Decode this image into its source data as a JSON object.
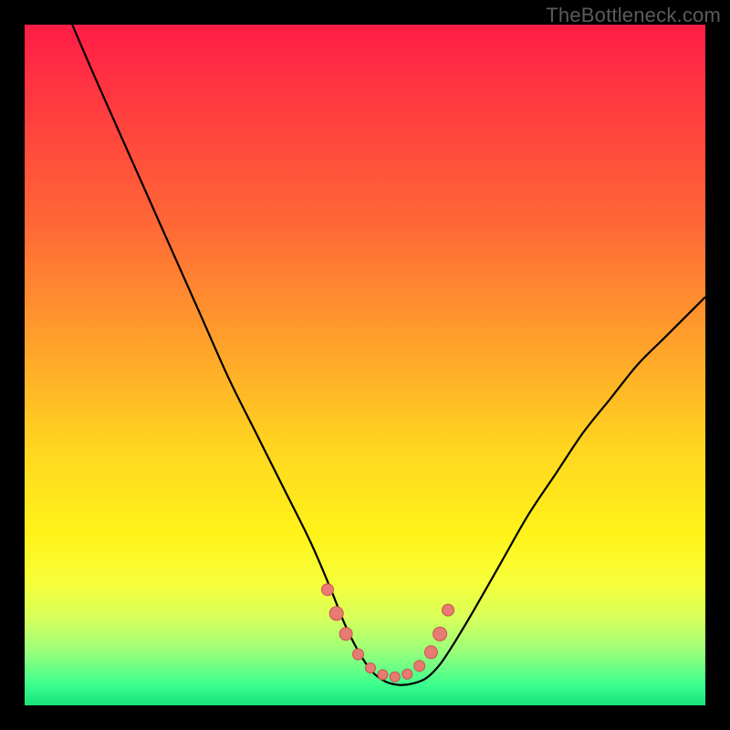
{
  "watermark": "TheBottleneck.com",
  "chart_data": {
    "type": "line",
    "title": "",
    "xlabel": "",
    "ylabel": "",
    "xlim": [
      0,
      100
    ],
    "ylim": [
      0,
      100
    ],
    "series": [
      {
        "name": "curve",
        "x": [
          7,
          10,
          14,
          18,
          22,
          26,
          30,
          34,
          38,
          42,
          45,
          47,
          49,
          51,
          53,
          55,
          57,
          59,
          61,
          63,
          66,
          70,
          74,
          78,
          82,
          86,
          90,
          94,
          98,
          100
        ],
        "y": [
          100,
          93,
          84,
          75,
          66,
          57,
          48,
          40,
          32,
          24,
          17,
          12,
          8,
          5,
          3.5,
          3,
          3.2,
          4,
          6,
          9,
          14,
          21,
          28,
          34,
          40,
          45,
          50,
          54,
          58,
          60
        ]
      }
    ],
    "markers": {
      "name": "cluster",
      "color": "#e77a72",
      "x": [
        44.5,
        45.8,
        47.2,
        49.0,
        50.8,
        52.6,
        54.4,
        56.2,
        58.0,
        59.7,
        61.0,
        62.2
      ],
      "y": [
        17.0,
        13.5,
        10.5,
        7.5,
        5.5,
        4.5,
        4.2,
        4.6,
        5.8,
        7.8,
        10.5,
        14.0
      ],
      "r": [
        6.5,
        7.5,
        7.0,
        6.0,
        5.5,
        5.5,
        5.5,
        5.5,
        6.0,
        7.0,
        7.5,
        6.5
      ]
    },
    "background_gradient": [
      "#ff1d47",
      "#ff6a36",
      "#ffd81f",
      "#f6ff3a",
      "#3bff8e"
    ]
  }
}
